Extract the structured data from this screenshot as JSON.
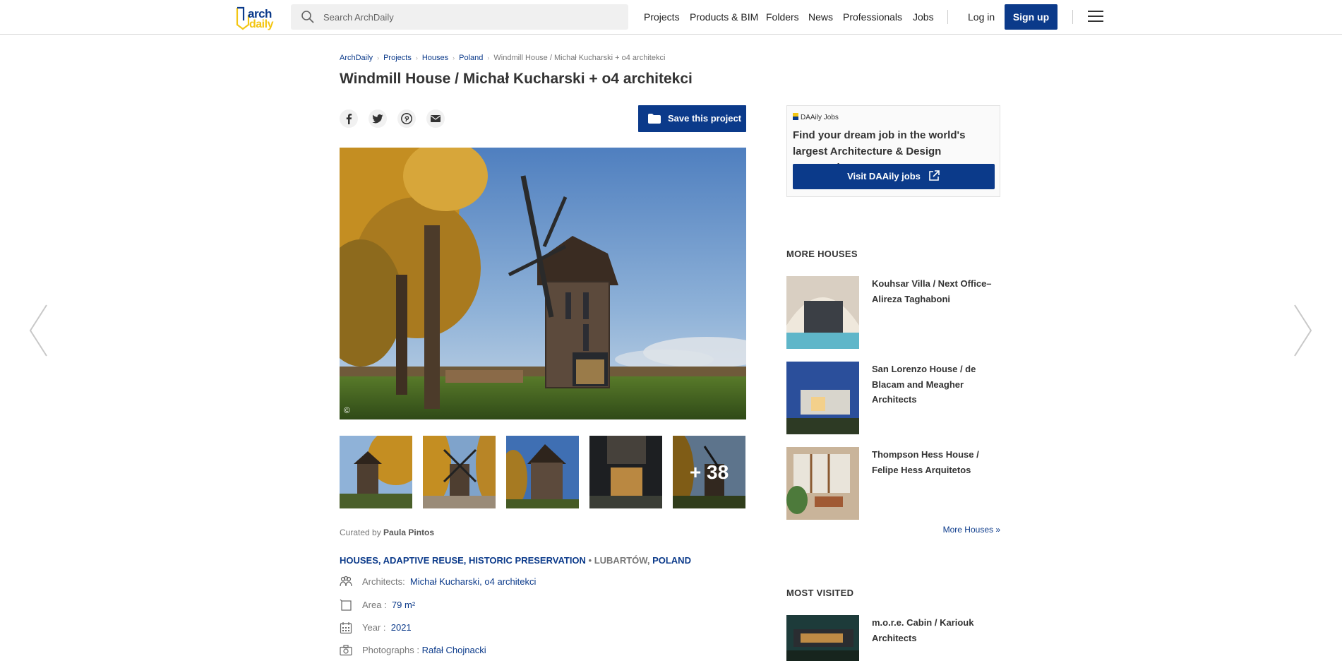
{
  "header": {
    "logo": {
      "line1": "arch",
      "line2": "daily"
    },
    "search": {
      "placeholder": "Search ArchDaily"
    },
    "nav": [
      {
        "label": "Projects"
      },
      {
        "label": "Products & BIM"
      },
      {
        "label": "Folders"
      },
      {
        "label": "News"
      },
      {
        "label": "Professionals"
      },
      {
        "label": "Jobs"
      }
    ],
    "login": "Log in",
    "signup": "Sign up"
  },
  "breadcrumb": {
    "items": [
      "ArchDaily",
      "Projects",
      "Houses",
      "Poland"
    ],
    "current": "Windmill House / Michał Kucharski + o4 architekci"
  },
  "project": {
    "title": "Windmill House / Michał Kucharski + o4 architekci",
    "save_label": "Save this project",
    "photo_credit_symbol": "©",
    "more_photos": "+ 38",
    "curated_prefix": "Curated by",
    "curator": "Paula Pintos",
    "tags": [
      "HOUSES",
      "ADAPTIVE REUSE",
      "HISTORIC PRESERVATION"
    ],
    "location_city": "LUBARTÓW",
    "location_country": "POLAND",
    "specs": {
      "architects_label": "Architects:",
      "architects_value": "Michał Kucharski, o4 architekci",
      "area_label": "Area :",
      "area_value": "79 m²",
      "year_label": "Year :",
      "year_value": "2021",
      "photographs_label": "Photographs :",
      "photographs_value": "Rafał Chojnacki"
    }
  },
  "sidebar": {
    "jobs": {
      "brand": "DAAily Jobs",
      "text": "Find your dream job in the world's largest Architecture & Design community.",
      "button": "Visit DAAily jobs"
    },
    "more_houses": {
      "heading": "MORE HOUSES",
      "items": [
        {
          "title": "Kouhsar Villa / Next Office–Alireza Taghaboni"
        },
        {
          "title": "San Lorenzo House / de Blacam and Meagher Architects"
        },
        {
          "title": "Thompson Hess House / Felipe Hess Arquitetos"
        }
      ],
      "more_link": "More Houses »"
    },
    "most_visited": {
      "heading": "MOST VISITED",
      "items": [
        {
          "title": "m.o.r.e. Cabin / Kariouk Architects"
        }
      ]
    }
  }
}
